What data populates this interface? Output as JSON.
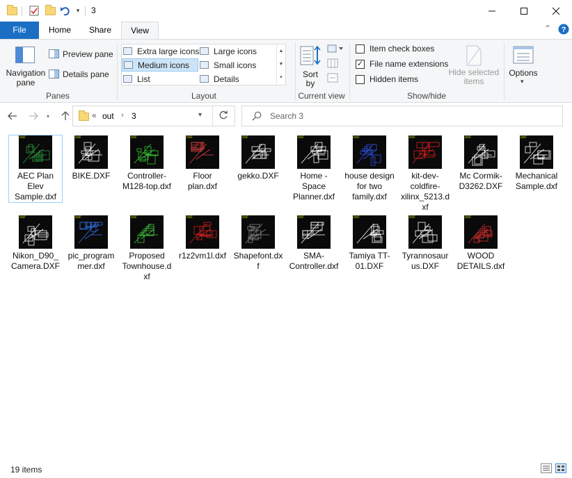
{
  "window": {
    "title": "3",
    "controls": [
      "minimize",
      "maximize",
      "close"
    ]
  },
  "ribbon": {
    "tabs": [
      "File",
      "Home",
      "Share",
      "View"
    ],
    "active_tab": "View",
    "panes": {
      "group_label": "Panes",
      "navigation_pane": "Navigation pane",
      "preview_pane": "Preview pane",
      "details_pane": "Details pane"
    },
    "layout": {
      "group_label": "Layout",
      "options": [
        {
          "label": "Extra large icons",
          "selected": false
        },
        {
          "label": "Large icons",
          "selected": false
        },
        {
          "label": "Medium icons",
          "selected": true
        },
        {
          "label": "Small icons",
          "selected": false
        },
        {
          "label": "List",
          "selected": false
        },
        {
          "label": "Details",
          "selected": false
        }
      ]
    },
    "current_view": {
      "group_label": "Current view",
      "sort_by": "Sort by"
    },
    "show_hide": {
      "group_label": "Show/hide",
      "item_check_boxes": {
        "label": "Item check boxes",
        "checked": false
      },
      "file_name_extensions": {
        "label": "File name extensions",
        "checked": true
      },
      "hidden_items": {
        "label": "Hidden items",
        "checked": false
      },
      "hide_selected_items": "Hide selected items"
    },
    "options": "Options"
  },
  "address": {
    "overflow": "«",
    "path": [
      "out",
      "3"
    ],
    "search_placeholder": "Search 3"
  },
  "files": [
    {
      "name": "AEC Plan Elev Sample.dxf",
      "selected": true,
      "color": "#2fa040"
    },
    {
      "name": "BIKE.DXF",
      "selected": false,
      "color": "#ffffff"
    },
    {
      "name": "Controller-M128-top.dxf",
      "selected": false,
      "color": "#35c435"
    },
    {
      "name": "Floor plan.dxf",
      "selected": false,
      "color": "#e04040"
    },
    {
      "name": "gekko.DXF",
      "selected": false,
      "color": "#ffffff"
    },
    {
      "name": "Home - Space Planner.dxf",
      "selected": false,
      "color": "#ffffff"
    },
    {
      "name": "house design for two family.dxf",
      "selected": false,
      "color": "#3050e0"
    },
    {
      "name": "kit-dev-coldfire-xilinx_5213.dxf",
      "selected": false,
      "color": "#e02020"
    },
    {
      "name": "Mc Cormik-D3262.DXF",
      "selected": false,
      "color": "#ffffff"
    },
    {
      "name": "Mechanical Sample.dxf",
      "selected": false,
      "color": "#ffffff"
    },
    {
      "name": "Nikon_D90_Camera.DXF",
      "selected": false,
      "color": "#ffffff"
    },
    {
      "name": "pic_programmer.dxf",
      "selected": false,
      "color": "#3070e0"
    },
    {
      "name": "Proposed Townhouse.dxf",
      "selected": false,
      "color": "#40c040"
    },
    {
      "name": "r1z2vm1l.dxf",
      "selected": false,
      "color": "#d02020"
    },
    {
      "name": "Shapefont.dxf",
      "selected": false,
      "color": "#888888"
    },
    {
      "name": "SMA-Controller.dxf",
      "selected": false,
      "color": "#ffffff"
    },
    {
      "name": "Tamiya TT-01.DXF",
      "selected": false,
      "color": "#ffffff"
    },
    {
      "name": "Tyrannosaurus.DXF",
      "selected": false,
      "color": "#ffffff"
    },
    {
      "name": "WOOD DETAILS.dxf",
      "selected": false,
      "color": "#e03030"
    }
  ],
  "thumbnail_badge": "DXF",
  "status": {
    "item_count": "19 items"
  }
}
